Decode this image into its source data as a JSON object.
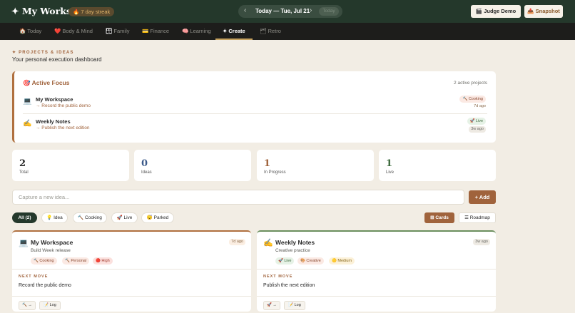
{
  "header": {
    "brand": "✦ My Workspace",
    "streak": "🔥 7 day streak",
    "date_prev": "‹",
    "date_text": "Today — Tue, Jul 21",
    "date_next": "›",
    "today_label": "Today",
    "judge_demo": "🎬 Judge Demo",
    "snapshot": "📤 Snapshot"
  },
  "nav": {
    "items": [
      {
        "label": "🏠 Today"
      },
      {
        "label": "❤️ Body & Mind"
      },
      {
        "label": "👪 Family"
      },
      {
        "label": "💳 Finance"
      },
      {
        "label": "🧠 Learning"
      },
      {
        "label": "✦ Create"
      },
      {
        "label": "🗂 Retro"
      }
    ],
    "active": "Create"
  },
  "page": {
    "eyebrow": "✦ PROJECTS & IDEAS",
    "subtitle": "Your personal execution dashboard"
  },
  "focus": {
    "title": "🎯 Active Focus",
    "count": "2 active projects",
    "projects": [
      {
        "icon": "💻",
        "name": "My Workspace",
        "next": "→ Record the public demo",
        "status": "🔨 Cooking",
        "age": "7d ago"
      },
      {
        "icon": "✍️",
        "name": "Weekly Notes",
        "next": "→ Publish the next edition",
        "status": "🚀 Live",
        "age": "3w ago"
      }
    ]
  },
  "stats": [
    {
      "value": "2",
      "label": "Total",
      "color": "#2a2a2a"
    },
    {
      "value": "0",
      "label": "Ideas",
      "color": "#3b5a8a"
    },
    {
      "value": "1",
      "label": "In Progress",
      "color": "#a0633c"
    },
    {
      "value": "1",
      "label": "Live",
      "color": "#3d6a3d"
    }
  ],
  "capture": {
    "placeholder": "Capture a new idea...",
    "value": "",
    "add_label": "+ Add"
  },
  "filters": [
    {
      "label": "All (2)"
    },
    {
      "label": "💡 Idea"
    },
    {
      "label": "🔨 Cooking"
    },
    {
      "label": "🚀 Live"
    },
    {
      "label": "😴 Parked"
    }
  ],
  "views": {
    "cards": "⊞ Cards",
    "roadmap": "☰ Roadmap"
  },
  "ideas": [
    {
      "icon": "💻",
      "title": "My Workspace",
      "subtitle": "Build Week release",
      "age": "7d ago",
      "tags": [
        "🔨 Cooking",
        "🔨 Personal",
        "🔴 High"
      ],
      "next_label": "NEXT MOVE",
      "next": "Record the public demo",
      "actions": [
        "🔨 →",
        "📝 Log"
      ]
    },
    {
      "icon": "✍️",
      "title": "Weekly Notes",
      "subtitle": "Creative practice",
      "age": "3w ago",
      "tags": [
        "🚀 Live",
        "🎨 Creative",
        "🟡 Medium"
      ],
      "next_label": "NEXT MOVE",
      "next": "Publish the next edition",
      "actions": [
        "🚀 →",
        "📝 Log"
      ]
    }
  ]
}
